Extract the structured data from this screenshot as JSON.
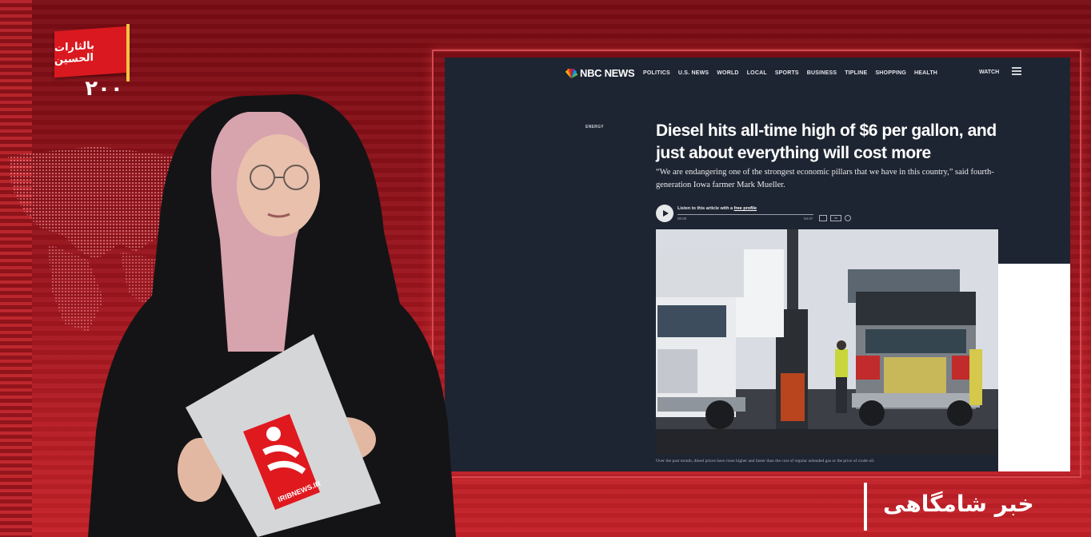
{
  "channel": {
    "logo_text": "بالثارات الحسین",
    "logo_number": "۲۰۰",
    "program_title": "خبر شامگاهی"
  },
  "article": {
    "brand": "NBC NEWS",
    "nav_items": [
      "POLITICS",
      "U.S. NEWS",
      "WORLD",
      "LOCAL",
      "SPORTS",
      "BUSINESS",
      "TIPLINE",
      "SHOPPING",
      "HEALTH"
    ],
    "watch_label": "WATCH",
    "section": "ENERGY",
    "headline": "Diesel hits all-time high of $6 per gallon, and just about everything will cost more",
    "dek": "“We are endangering one of the strongest economic pillars that we have in this country,” said fourth-generation Iowa farmer Mark Mueller.",
    "audio": {
      "listen_prefix": "Listen to this article with a",
      "listen_link": "free profile",
      "time_start": "00:00",
      "time_end": "04:47",
      "speed": "1x"
    },
    "caption": "Over the past month, diesel prices have risen higher and faster than the cost of regular unleaded gas or the price of crude oil."
  },
  "clipboard": {
    "site": "IRIBNEWS.IR"
  },
  "colors": {
    "studio_red": "#a3161f",
    "screen_bg": "#1e2532",
    "logo_red": "#d9191f"
  }
}
